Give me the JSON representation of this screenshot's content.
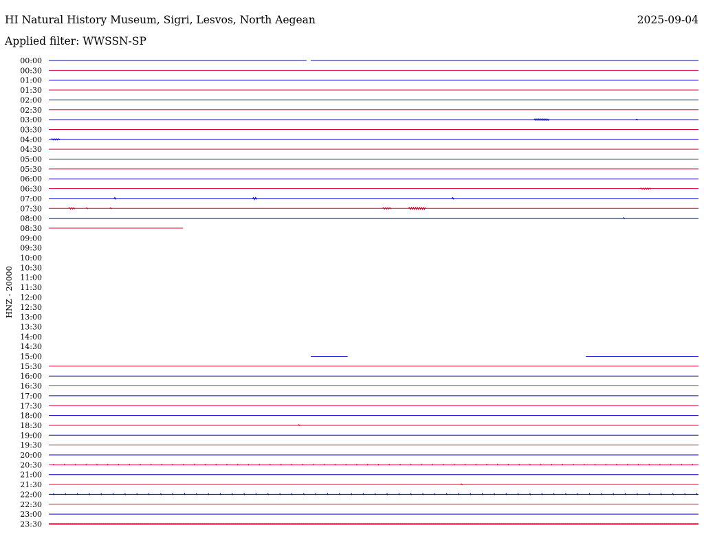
{
  "header": {
    "station_title": "HI Natural History Museum, Sigri, Lesvos, North Aegean",
    "date": "2025-09-04",
    "filter_text": "Applied filter: WWSSN-SP"
  },
  "channel_label": "HNZ - 20000",
  "colors": {
    "trace_a": "#0000cc",
    "trace_b": "#e0002c",
    "background": "#ffffff",
    "text": "#000000"
  },
  "chart_data": {
    "type": "line",
    "chart_subtype": "helicorder",
    "x_extent_minutes": [
      0,
      30
    ],
    "row_labels": [
      "00:00",
      "00:30",
      "01:00",
      "01:30",
      "02:00",
      "02:30",
      "03:00",
      "03:30",
      "04:00",
      "04:30",
      "05:00",
      "05:30",
      "06:00",
      "06:30",
      "07:00",
      "07:30",
      "08:00",
      "08:30",
      "09:00",
      "09:30",
      "10:00",
      "10:30",
      "11:00",
      "11:30",
      "12:00",
      "12:30",
      "13:00",
      "13:30",
      "14:00",
      "14:30",
      "15:00",
      "15:30",
      "16:00",
      "16:30",
      "17:00",
      "17:30",
      "18:00",
      "18:30",
      "19:00",
      "19:30",
      "20:00",
      "20:30",
      "21:00",
      "21:30",
      "22:00",
      "22:30",
      "23:00",
      "23:30"
    ],
    "row_colors": [
      "trace_a",
      "trace_b"
    ],
    "segments": [
      {
        "row": 0,
        "from": 0,
        "to": 11.9
      },
      {
        "row": 0,
        "from": 12.1,
        "to": 30
      },
      {
        "row": 1,
        "from": 0,
        "to": 30
      },
      {
        "row": 2,
        "from": 0,
        "to": 30
      },
      {
        "row": 3,
        "from": 0,
        "to": 30
      },
      {
        "row": 4,
        "from": 0,
        "to": 30
      },
      {
        "row": 5,
        "from": 0,
        "to": 30
      },
      {
        "row": 6,
        "from": 0,
        "to": 30
      },
      {
        "row": 7,
        "from": 0,
        "to": 30
      },
      {
        "row": 8,
        "from": 0,
        "to": 30
      },
      {
        "row": 9,
        "from": 0,
        "to": 30
      },
      {
        "row": 10,
        "from": 0,
        "to": 30
      },
      {
        "row": 11,
        "from": 0,
        "to": 30
      },
      {
        "row": 12,
        "from": 0,
        "to": 30
      },
      {
        "row": 13,
        "from": 0,
        "to": 30
      },
      {
        "row": 14,
        "from": 0,
        "to": 30
      },
      {
        "row": 15,
        "from": 0,
        "to": 30
      },
      {
        "row": 16,
        "from": 0,
        "to": 30
      },
      {
        "row": 17,
        "from": 0,
        "to": 6.2
      },
      {
        "row": 30,
        "from": 12.1,
        "to": 13.8
      },
      {
        "row": 30,
        "from": 24.8,
        "to": 30
      },
      {
        "row": 31,
        "from": 0,
        "to": 30
      },
      {
        "row": 32,
        "from": 0,
        "to": 30
      },
      {
        "row": 33,
        "from": 0,
        "to": 30
      },
      {
        "row": 34,
        "from": 0,
        "to": 30
      },
      {
        "row": 35,
        "from": 0,
        "to": 30
      },
      {
        "row": 36,
        "from": 0,
        "to": 30
      },
      {
        "row": 37,
        "from": 0,
        "to": 30
      },
      {
        "row": 38,
        "from": 0,
        "to": 30
      },
      {
        "row": 39,
        "from": 0,
        "to": 30
      },
      {
        "row": 40,
        "from": 0,
        "to": 30
      },
      {
        "row": 41,
        "from": 0,
        "to": 30
      },
      {
        "row": 42,
        "from": 0,
        "to": 30
      },
      {
        "row": 43,
        "from": 0,
        "to": 30
      },
      {
        "row": 44,
        "from": 0,
        "to": 30
      },
      {
        "row": 45,
        "from": 0,
        "to": 30
      },
      {
        "row": 46,
        "from": 0,
        "to": 30
      },
      {
        "row": 47,
        "from": 0,
        "to": 30
      }
    ],
    "events": [
      {
        "row": 6,
        "minute": 22.4,
        "duration": 0.7,
        "amplitude": 1.2
      },
      {
        "row": 6,
        "minute": 27.1,
        "duration": 0.1,
        "amplitude": 0.8
      },
      {
        "row": 8,
        "minute": 0.1,
        "duration": 0.4,
        "amplitude": 1.0
      },
      {
        "row": 13,
        "minute": 27.3,
        "duration": 0.5,
        "amplitude": 1.0
      },
      {
        "row": 14,
        "minute": 3.0,
        "duration": 0.1,
        "amplitude": 1.5
      },
      {
        "row": 14,
        "minute": 9.4,
        "duration": 0.2,
        "amplitude": 1.5
      },
      {
        "row": 14,
        "minute": 18.6,
        "duration": 0.1,
        "amplitude": 1.5
      },
      {
        "row": 15,
        "minute": 0.9,
        "duration": 0.3,
        "amplitude": 1.2
      },
      {
        "row": 15,
        "minute": 1.7,
        "duration": 0.1,
        "amplitude": 1.0
      },
      {
        "row": 15,
        "minute": 2.8,
        "duration": 0.1,
        "amplitude": 1.0
      },
      {
        "row": 15,
        "minute": 15.4,
        "duration": 0.4,
        "amplitude": 1.2
      },
      {
        "row": 15,
        "minute": 16.6,
        "duration": 0.8,
        "amplitude": 1.5
      },
      {
        "row": 16,
        "minute": 26.5,
        "duration": 0.1,
        "amplitude": 0.8
      },
      {
        "row": 37,
        "minute": 11.5,
        "duration": 0.1,
        "amplitude": 1.0
      },
      {
        "row": 43,
        "minute": 19.0,
        "duration": 0.1,
        "amplitude": 1.0
      },
      {
        "row": 47,
        "minute": 0,
        "duration": 30,
        "amplitude": 0.6
      }
    ],
    "tick_bursts": [
      {
        "row": 41,
        "spacing": 0.5,
        "amplitude": 0.8
      },
      {
        "row": 44,
        "spacing": 0.55,
        "amplitude": 1.0
      }
    ]
  }
}
